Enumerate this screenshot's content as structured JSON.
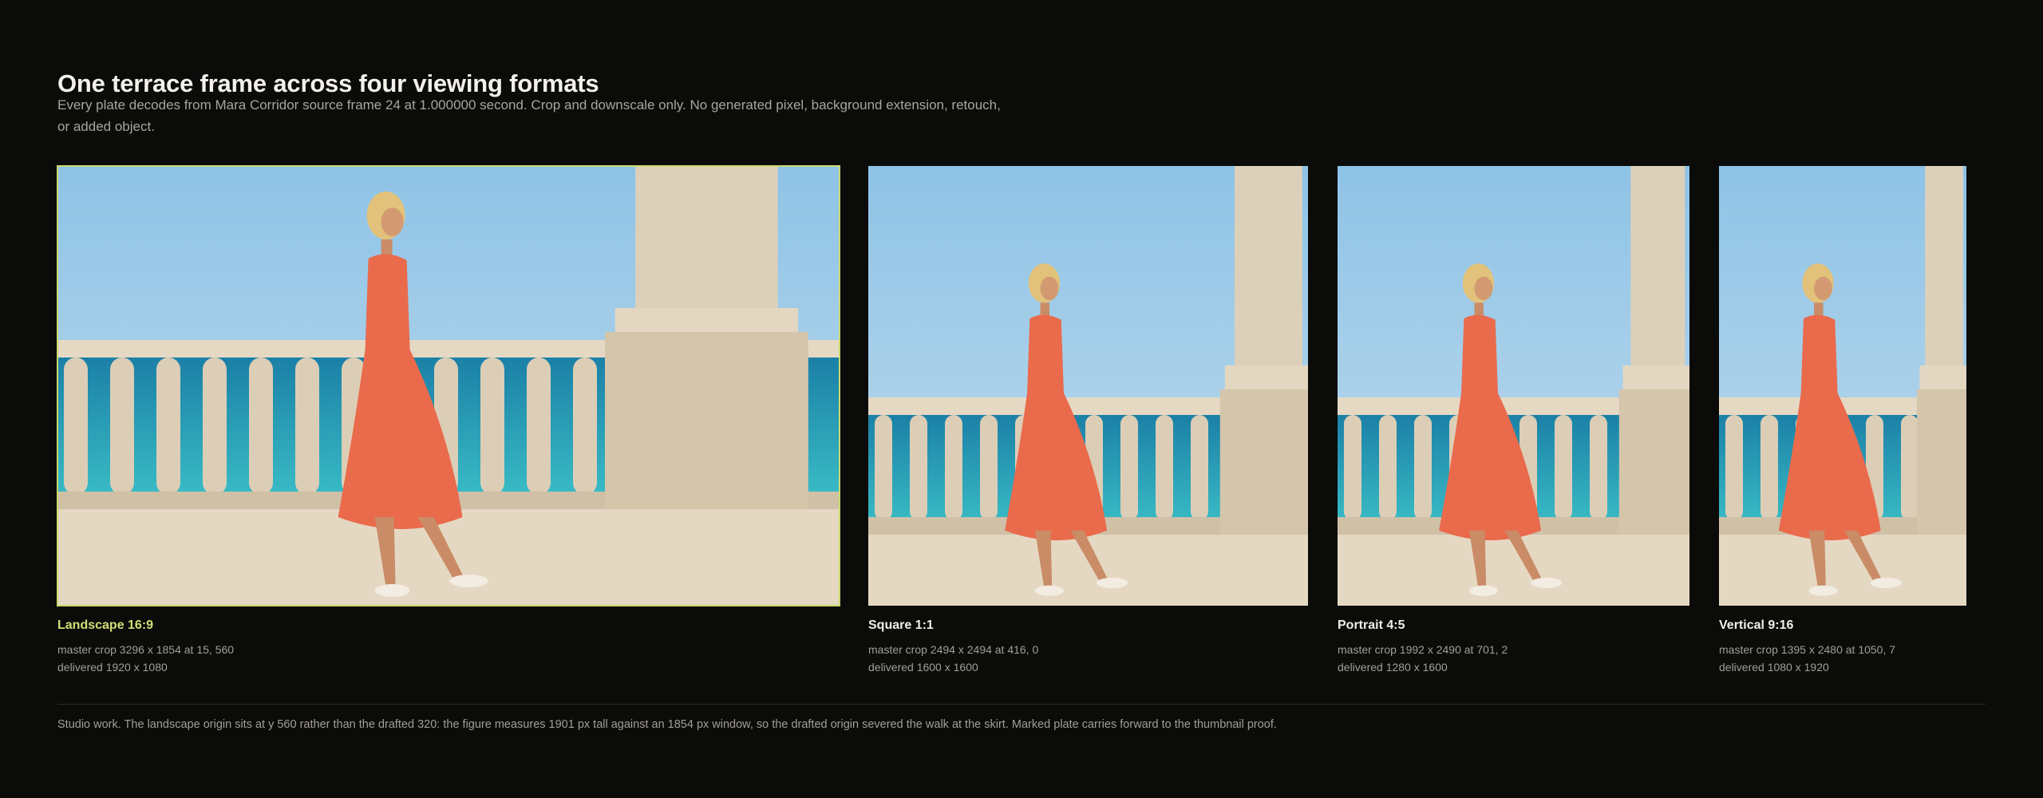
{
  "header": {
    "title": "One terrace frame across four viewing formats",
    "subtitle": "Every plate decodes from Mara Corridor source frame 24 at 1.000000 second. Crop and downscale only. No generated pixel, background extension, retouch, or added object."
  },
  "plates": [
    {
      "label": "Landscape 16:9",
      "crop": "master crop 3296 x 1854 at 15, 560",
      "delivered": "delivered 1920 x 1080",
      "marked": true
    },
    {
      "label": "Square 1:1",
      "crop": "master crop 2494 x 2494 at 416, 0",
      "delivered": "delivered 1600 x 1600",
      "marked": false
    },
    {
      "label": "Portrait 4:5",
      "crop": "master crop 1992 x 2490 at 701, 2",
      "delivered": "delivered 1280 x 1600",
      "marked": false
    },
    {
      "label": "Vertical 9:16",
      "crop": "master crop 1395 x 2480 at 1050, 7",
      "delivered": "delivered 1080 x 1920",
      "marked": false
    }
  ],
  "footer": {
    "note": "Studio work. The landscape origin sits at y 560 rather than the drafted 320: the figure measures 1901 px tall against an 1854 px window, so the drafted origin severed the walk at the skirt. Marked plate carries forward to the thumbnail proof."
  },
  "colors": {
    "background": "#0b0b09",
    "accent": "#c9d86e",
    "sky": "#87bde0",
    "sea": "#1d9cb4",
    "stone": "#dccfb8",
    "dress": "#ea6a4c"
  }
}
